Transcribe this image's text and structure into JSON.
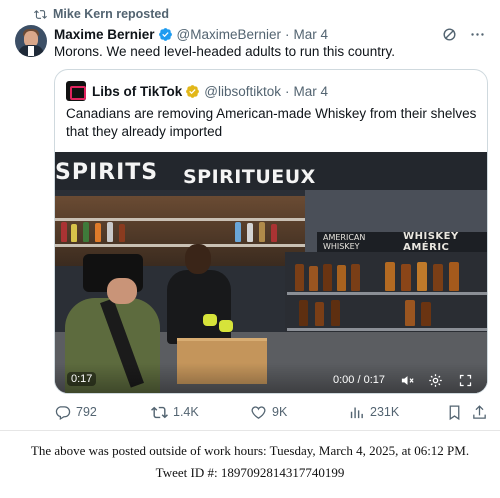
{
  "repost": {
    "label": "Mike Kern reposted"
  },
  "author": {
    "name": "Maxime Bernier",
    "handle": "@MaximeBernier",
    "separator": "·",
    "date": "Mar 4",
    "text": "Morons. We need level-headed adults to run this country."
  },
  "quoted": {
    "name": "Libs of TikTok",
    "handle": "@libsoftiktok",
    "separator": "·",
    "date": "Mar 4",
    "text": "Canadians are removing American-made Whiskey from their shelves that they already imported",
    "video": {
      "sign_left": "SPIRITS",
      "sign_right": "SPIRITUEUX",
      "banner_left": "AMERICAN WHISKEY",
      "banner_right": "WHISKEY AMÉRIC",
      "elapsed": "0:17",
      "progress": "0:00 / 0:17"
    }
  },
  "actions": {
    "replies": "792",
    "reposts": "1.4K",
    "likes": "9K",
    "views": "231K"
  },
  "footer": {
    "line1": "The above was posted outside of work hours: Tuesday, March 4, 2025, at 06:12 PM.",
    "line2": "Tweet ID #: 1897092814317740199"
  },
  "colors": {
    "verified_blue": "#1d9bf0",
    "verified_gold": "#e2b719",
    "muted_text": "#536471",
    "border": "#cfd9de"
  }
}
